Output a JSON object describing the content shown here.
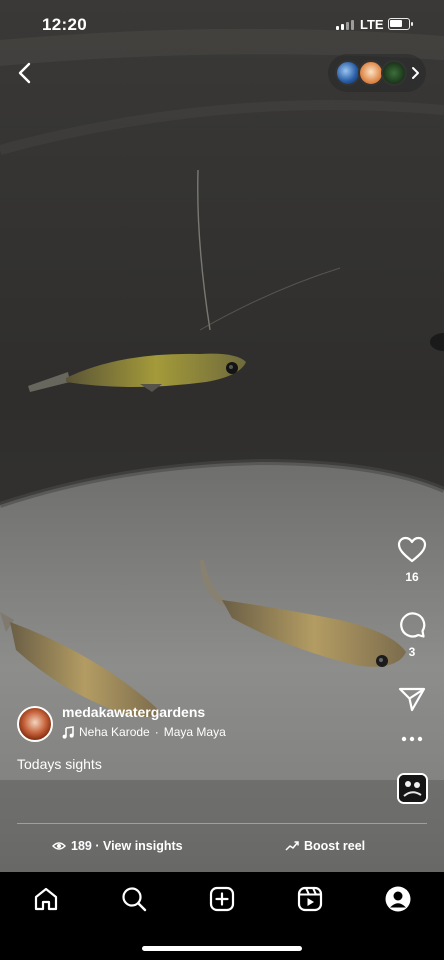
{
  "status_bar": {
    "time": "12:20",
    "network": "LTE"
  },
  "author": {
    "username": "medakawatergardens"
  },
  "audio": {
    "artist": "Neha Karode",
    "separator": "·",
    "track": "Maya Maya"
  },
  "caption": "Todays sights",
  "actions": {
    "likes": "16",
    "comments": "3"
  },
  "footer": {
    "insights_label": "189 · View insights",
    "boost_label": "Boost reel"
  },
  "colors": {
    "accent": "#ffffff",
    "tab_bar": "#000000"
  },
  "icons": {
    "back": "chevron-left-icon",
    "like": "heart-icon",
    "comment": "comment-icon",
    "share": "send-icon",
    "more": "more-horizontal-icon",
    "music": "music-note-icon",
    "views": "eye-icon",
    "boost": "trending-up-icon",
    "tabs": [
      "home-icon",
      "search-icon",
      "new-post-icon",
      "reels-icon",
      "profile-icon"
    ]
  }
}
